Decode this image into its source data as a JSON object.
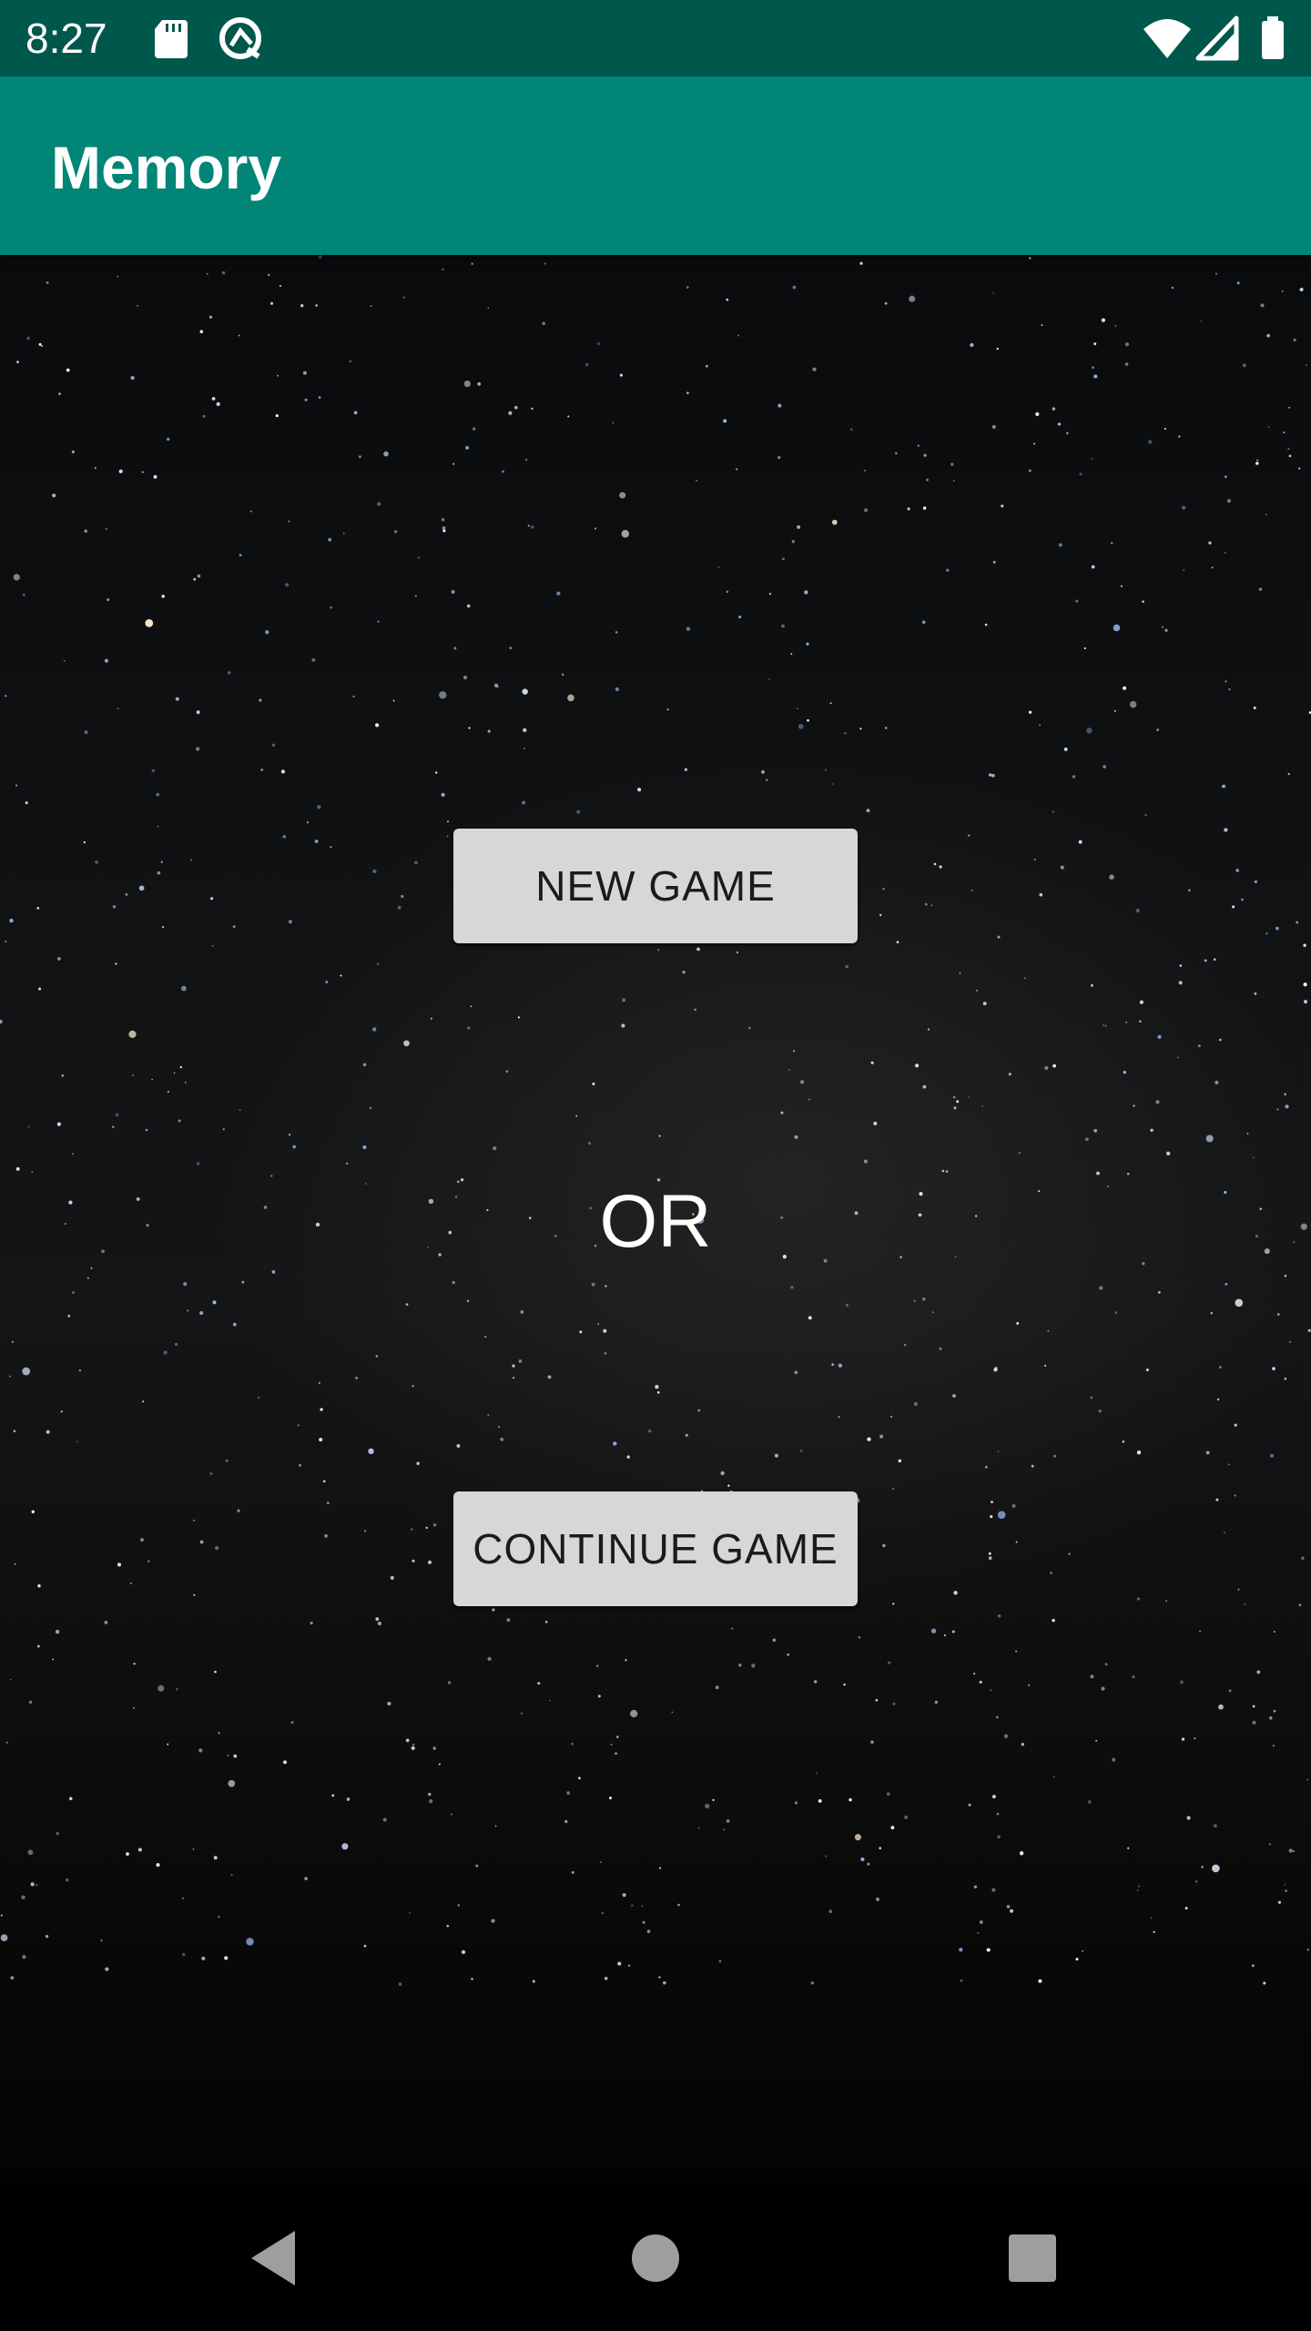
{
  "status_bar": {
    "time": "8:27",
    "icons": [
      "sd-card-icon",
      "sync-icon",
      "wifi-icon",
      "cell-signal-icon",
      "battery-icon"
    ]
  },
  "app_bar": {
    "title": "Memory"
  },
  "main": {
    "new_game_label": "NEW GAME",
    "or_label": "OR",
    "continue_game_label": "CONTINUE GAME"
  },
  "nav_bar": {
    "buttons": [
      "back-icon",
      "home-icon",
      "recents-icon"
    ]
  },
  "colors": {
    "status_bar": "#00574b",
    "app_bar": "#008577",
    "button_bg": "#d6d7d7",
    "button_text": "#1b1b1b"
  }
}
